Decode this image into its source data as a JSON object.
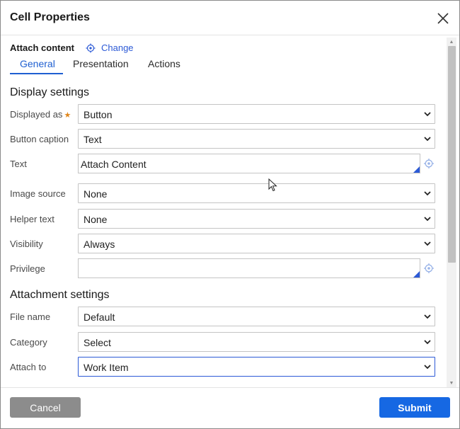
{
  "dialog": {
    "title": "Cell Properties",
    "close_icon": "close-icon"
  },
  "header": {
    "section_label": "Attach content",
    "change_link": "Change",
    "change_icon": "target-icon"
  },
  "tabs": [
    {
      "label": "General",
      "active": true
    },
    {
      "label": "Presentation",
      "active": false
    },
    {
      "label": "Actions",
      "active": false
    }
  ],
  "display_settings": {
    "title": "Display settings",
    "fields": {
      "displayed_as": {
        "label": "Displayed as",
        "value": "Button",
        "required": true
      },
      "button_caption": {
        "label": "Button caption",
        "value": "Text"
      },
      "text": {
        "label": "Text",
        "value": "Attach Content"
      },
      "image_source": {
        "label": "Image source",
        "value": "None"
      },
      "helper_text": {
        "label": "Helper text",
        "value": "None"
      },
      "visibility": {
        "label": "Visibility",
        "value": "Always"
      },
      "privilege": {
        "label": "Privilege",
        "value": ""
      }
    }
  },
  "attachment_settings": {
    "title": "Attachment settings",
    "fields": {
      "file_name": {
        "label": "File name",
        "value": "Default"
      },
      "category": {
        "label": "Category",
        "value": "Select"
      },
      "attach_to": {
        "label": "Attach to",
        "value": "Work Item"
      }
    }
  },
  "footer": {
    "cancel": "Cancel",
    "submit": "Submit"
  },
  "colors": {
    "accent": "#1f5fd1",
    "submit": "#1668e3",
    "cancel": "#8c8c8c",
    "required_star": "#e0861a"
  }
}
